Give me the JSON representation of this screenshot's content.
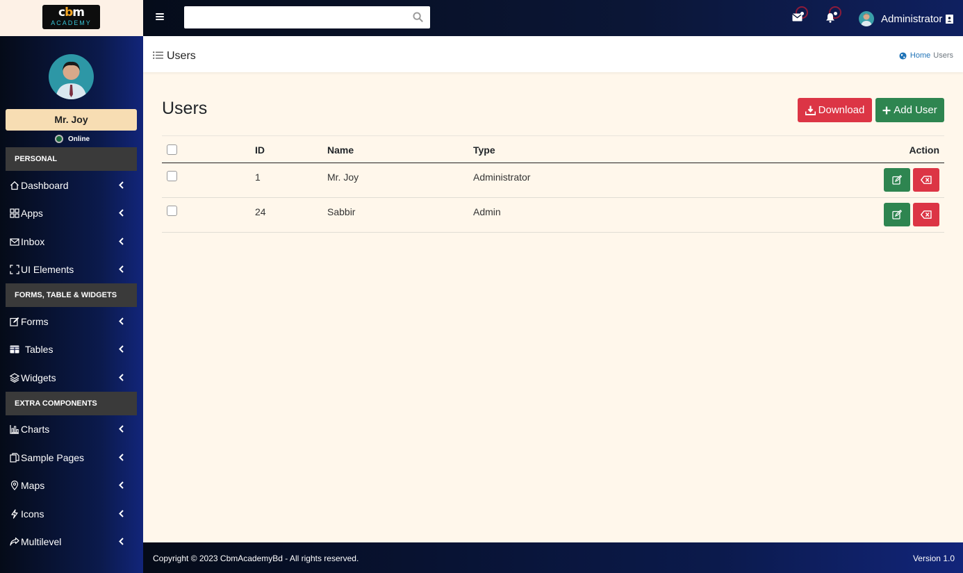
{
  "brand": {
    "logo_text": "cbm",
    "logo_sub": "ACADEMY"
  },
  "header": {
    "search_placeholder": "",
    "user_name": "Administrator"
  },
  "sidebar": {
    "profile_name": "Mr. Joy",
    "status": "Online",
    "sections": [
      "PERSONAL",
      "FORMS, TABLE & WIDGETS",
      "EXTRA COMPONENTS"
    ],
    "items": [
      {
        "label": "Dashboard",
        "icon": "home-icon"
      },
      {
        "label": "Apps",
        "icon": "grid-icon"
      },
      {
        "label": "Inbox",
        "icon": "envelope-icon"
      },
      {
        "label": "UI Elements",
        "icon": "fullscreen-icon"
      },
      {
        "label": "Forms",
        "icon": "edit-icon"
      },
      {
        "label": "Tables",
        "icon": "table-icon"
      },
      {
        "label": "Widgets",
        "icon": "layers-icon"
      },
      {
        "label": "Charts",
        "icon": "bar-chart-icon"
      },
      {
        "label": "Sample Pages",
        "icon": "files-icon"
      },
      {
        "label": "Maps",
        "icon": "map-pin-icon"
      },
      {
        "label": "Icons",
        "icon": "lightning-icon"
      },
      {
        "label": "Multilevel",
        "icon": "share-icon"
      }
    ]
  },
  "breadcrumb": {
    "title": "Users",
    "home": "Home",
    "current": "Users"
  },
  "main": {
    "heading": "Users",
    "download_label": "Download",
    "add_label": "Add User",
    "columns": {
      "id": "ID",
      "name": "Name",
      "type": "Type",
      "action": "Action"
    },
    "rows": [
      {
        "id": "1",
        "name": "Mr. Joy",
        "type": "Administrator"
      },
      {
        "id": "24",
        "name": "Sabbir",
        "type": "Admin"
      }
    ]
  },
  "footer": {
    "copyright": "Copyright © 2023 CbmAcademyBd - All rights reserved.",
    "version": "Version 1.0"
  },
  "colors": {
    "danger": "#dc3545",
    "success": "#2e8550",
    "link": "#1f73b7"
  }
}
